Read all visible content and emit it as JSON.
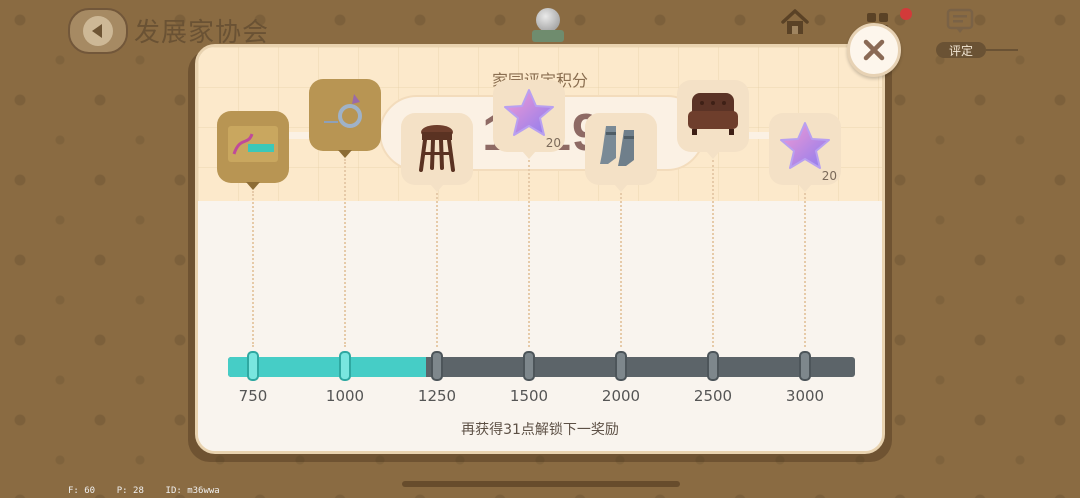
{
  "screen": {
    "title": "发展家协会"
  },
  "topbar": {
    "rate_tab_label": "评定"
  },
  "panel": {
    "title": "家园评定积分",
    "score": "1219",
    "hint": "再获得31点解锁下一奖励"
  },
  "progress": {
    "current": 1219,
    "next_threshold": 1250,
    "milestones": [
      "750",
      "1000",
      "1250",
      "1500",
      "2000",
      "2500",
      "3000"
    ]
  },
  "rewards": [
    {
      "icon": "poster-icon",
      "count": "",
      "claimed": true
    },
    {
      "icon": "ring-icon",
      "count": "",
      "claimed": true
    },
    {
      "icon": "stool-icon",
      "count": "",
      "claimed": false
    },
    {
      "icon": "star-icon",
      "count": "20",
      "claimed": false
    },
    {
      "icon": "boots-icon",
      "count": "",
      "claimed": false
    },
    {
      "icon": "armchair-icon",
      "count": "",
      "claimed": false
    },
    {
      "icon": "star-icon",
      "count": "20",
      "claimed": false
    }
  ],
  "debug": {
    "text": "F: 60    P: 28    ID: m36wwa"
  },
  "colors": {
    "fill": "#46cdc6",
    "track": "#5c6469",
    "score": "#8e6a64"
  }
}
